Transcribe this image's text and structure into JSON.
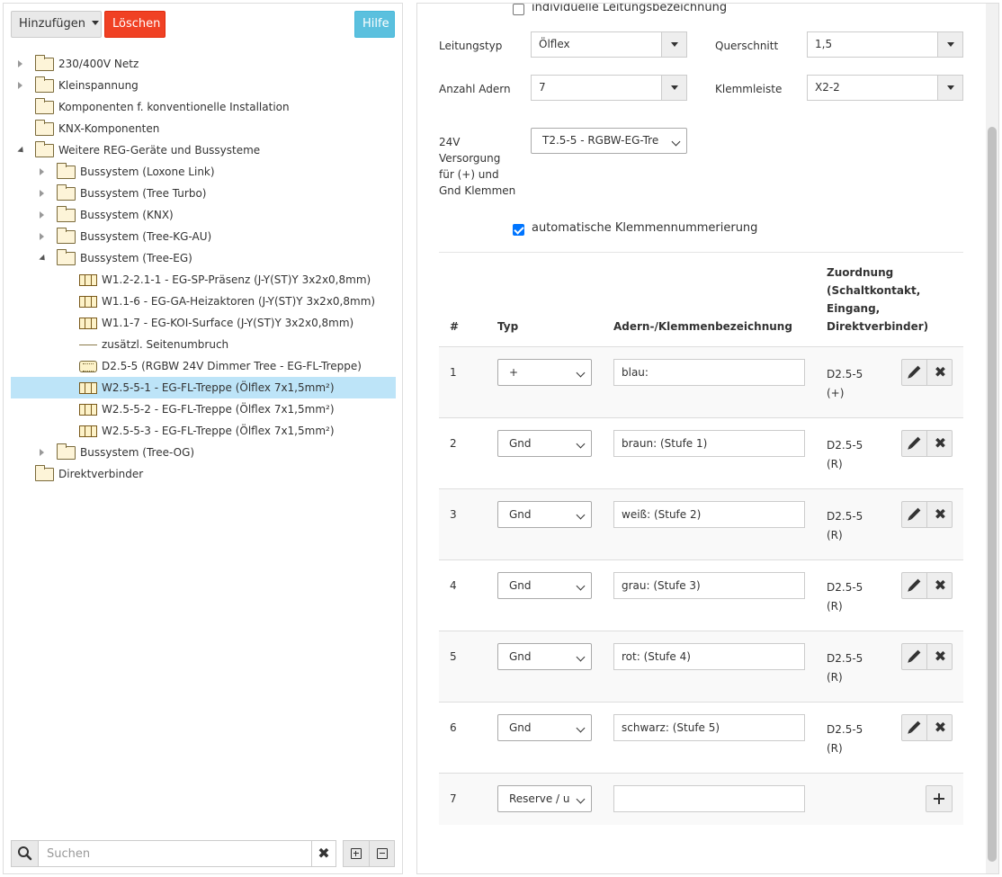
{
  "toolbar": {
    "add_label": "Hinzufügen",
    "delete_label": "Löschen",
    "help_label": "Hilfe"
  },
  "tree": {
    "items": [
      {
        "label": "230/400V Netz",
        "icon": "folder",
        "toggle": "closed"
      },
      {
        "label": "Kleinspannung",
        "icon": "folder",
        "toggle": "closed"
      },
      {
        "label": "Komponenten f. konventionelle Installation",
        "icon": "folder",
        "toggle": "none"
      },
      {
        "label": "KNX-Komponenten",
        "icon": "folder",
        "toggle": "none"
      },
      {
        "label": "Weitere REG-Geräte und Bussysteme",
        "icon": "folder",
        "toggle": "open"
      },
      {
        "label": "Bussystem (Loxone Link)",
        "icon": "folder",
        "toggle": "closed"
      },
      {
        "label": "Bussystem (Tree Turbo)",
        "icon": "folder",
        "toggle": "closed"
      },
      {
        "label": "Bussystem (KNX)",
        "icon": "folder",
        "toggle": "closed"
      },
      {
        "label": "Bussystem (Tree-KG-AU)",
        "icon": "folder",
        "toggle": "closed"
      },
      {
        "label": "Bussystem (Tree-EG)",
        "icon": "folder",
        "toggle": "open"
      },
      {
        "label": "W1.2-2.1-1 - EG-SP-Präsenz (J-Y(ST)Y 3x2x0,8mm)",
        "icon": "cable",
        "toggle": "none"
      },
      {
        "label": "W1.1-6 - EG-GA-Heizaktoren (J-Y(ST)Y 3x2x0,8mm)",
        "icon": "cable",
        "toggle": "none"
      },
      {
        "label": "W1.1-7 - EG-KOI-Surface (J-Y(ST)Y 3x2x0,8mm)",
        "icon": "cable",
        "toggle": "none"
      },
      {
        "label": "zusätzl. Seitenumbruch",
        "icon": "line",
        "toggle": "none"
      },
      {
        "label": "D2.5-5 (RGBW 24V Dimmer Tree - EG-FL-Treppe)",
        "icon": "dimmer",
        "toggle": "none"
      },
      {
        "label": "W2.5-5-1 - EG-FL-Treppe (Ölflex 7x1,5mm²)",
        "icon": "cable",
        "toggle": "none"
      },
      {
        "label": "W2.5-5-2 - EG-FL-Treppe (Ölflex 7x1,5mm²)",
        "icon": "cable",
        "toggle": "none"
      },
      {
        "label": "W2.5-5-3 - EG-FL-Treppe (Ölflex 7x1,5mm²)",
        "icon": "cable",
        "toggle": "none"
      },
      {
        "label": "Bussystem (Tree-OG)",
        "icon": "folder",
        "toggle": "closed"
      },
      {
        "label": "Direktverbinder",
        "icon": "folder",
        "toggle": "none"
      }
    ]
  },
  "search": {
    "placeholder": "Suchen",
    "clear_label": "✖"
  },
  "form": {
    "individual_label": "individuelle Leitungsbezeichnung",
    "individual_checked": false,
    "cable_type_label": "Leitungstyp",
    "cable_type_value": "Ölflex",
    "cross_section_label": "Querschnitt",
    "cross_section_value": "1,5",
    "wire_count_label": "Anzahl Adern",
    "wire_count_value": "7",
    "terminal_strip_label": "Klemmleiste",
    "terminal_strip_value": "X2-2",
    "supply_label_lines": [
      "24V",
      "Versorgung",
      "für (+) und",
      "Gnd Klemmen"
    ],
    "supply_value": "T2.5-5 - RGBW-EG-Tre",
    "auto_numbering_label": "automatische Klemmennummerierung",
    "auto_numbering_checked": true
  },
  "table": {
    "headers": {
      "num": "#",
      "type": "Typ",
      "designation": "Adern-/Klemmenbezeichnung",
      "assignment_lines": [
        "Zuordnung",
        "(Schaltkontakt,",
        "Eingang,",
        "Direktverbinder)"
      ]
    },
    "rows": [
      {
        "num": "1",
        "type": "+",
        "designation": "blau:",
        "assign1": "D2.5-5",
        "assign2": "(+)"
      },
      {
        "num": "2",
        "type": "Gnd",
        "designation": "braun: (Stufe 1)",
        "assign1": "D2.5-5",
        "assign2": "(R)"
      },
      {
        "num": "3",
        "type": "Gnd",
        "designation": "weiß: (Stufe 2)",
        "assign1": "D2.5-5",
        "assign2": "(R)"
      },
      {
        "num": "4",
        "type": "Gnd",
        "designation": "grau: (Stufe 3)",
        "assign1": "D2.5-5",
        "assign2": "(R)"
      },
      {
        "num": "5",
        "type": "Gnd",
        "designation": "rot: (Stufe 4)",
        "assign1": "D2.5-5",
        "assign2": "(R)"
      },
      {
        "num": "6",
        "type": "Gnd",
        "designation": "schwarz: (Stufe 5)",
        "assign1": "D2.5-5",
        "assign2": "(R)"
      },
      {
        "num": "7",
        "type": "Reserve / u",
        "designation": "",
        "assign1": "",
        "assign2": ""
      }
    ]
  },
  "colors": {
    "delete": "#f04124",
    "help": "#5bc0de",
    "selected": "#bde4f8",
    "check": "#0075ff"
  }
}
